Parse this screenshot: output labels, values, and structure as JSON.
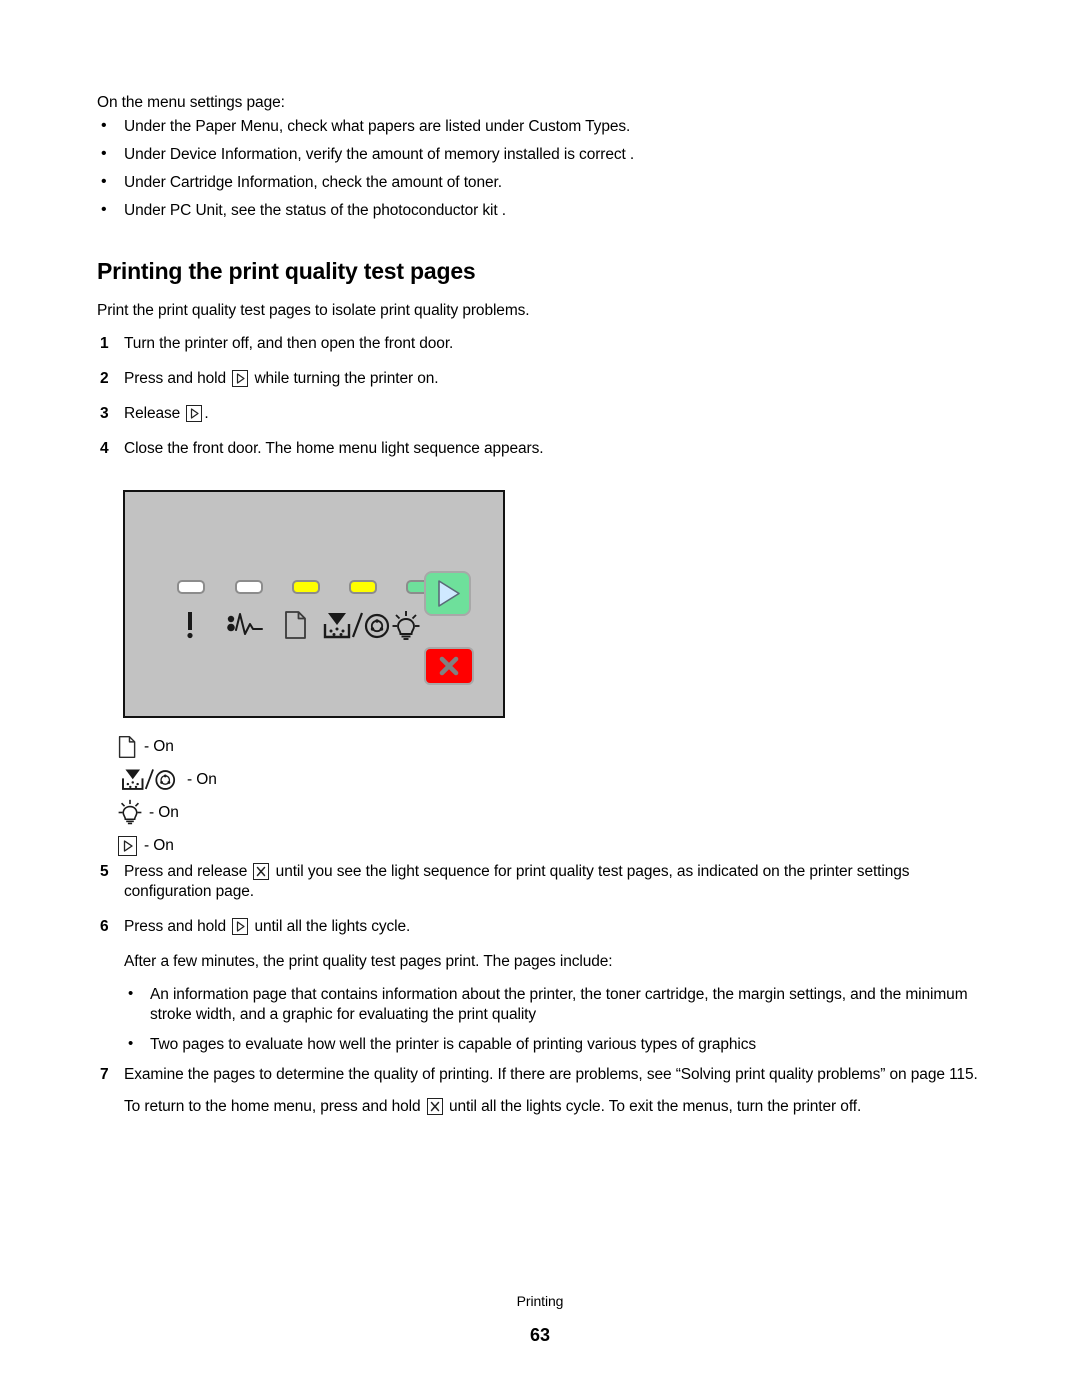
{
  "intro": {
    "lead": "On the menu settings page:",
    "bullets": [
      "Under the Paper Menu, check what papers are listed under Custom Types.",
      "Under Device Information, verify the amount of memory installed is correct .",
      "Under Cartridge Information, check the amount of toner.",
      "Under PC Unit, see the status of the photoconductor kit ."
    ]
  },
  "section": {
    "heading": "Printing the print quality test pages",
    "intro": "Print the print quality test pages to isolate print quality problems."
  },
  "steps": {
    "s1_num": "1",
    "s1_text": "Turn the printer off, and then open the front door.",
    "s2_num": "2",
    "s2_a": "Press and hold",
    "s2_b": "while turning the printer on.",
    "s3_num": "3",
    "s3_a": "Release",
    "s3_b": ".",
    "s4_num": "4",
    "s4_text": "Close the front door. The home menu light sequence appears.",
    "s5_num": "5",
    "s5_a": "Press and release",
    "s5_b": "until you see the light sequence for print quality test pages, as indicated on the printer settings configuration page.",
    "s6_num": "6",
    "s6_a": "Press and hold",
    "s6_b": "until all the lights cycle.",
    "s6_after": "After a few minutes, the print quality test pages print. The pages include:",
    "s6_bullets": [
      "An information page that contains information about the printer, the toner cartridge, the margin settings, and the minimum stroke width, and a graphic for evaluating the print quality",
      "Two pages to evaluate how well the printer is capable of printing various types of graphics"
    ],
    "s7_num": "7",
    "s7_text": "Examine the pages to determine the quality of printing. If there are problems, see “Solving print quality problems” on page 115.",
    "closing_a": "To return to the home menu, press and hold",
    "closing_b": "until all the lights cycle. To exit the menus, turn the printer off."
  },
  "panel": {
    "leds": [
      {
        "name": "error-led",
        "color": "#ffffff"
      },
      {
        "name": "paper-jam-led",
        "color": "#ffffff"
      },
      {
        "name": "load-paper-led",
        "color": "#ffff00"
      },
      {
        "name": "toner-led",
        "color": "#ffff00"
      },
      {
        "name": "ready-led",
        "color": "#6ee09b"
      }
    ],
    "icons": [
      "exclamation-icon",
      "paper-jam-icon",
      "paper-icon",
      "toner-pc-unit-icon",
      "lightbulb-icon"
    ],
    "go_button": "go-button",
    "stop_button": "stop-button",
    "go_color": "#6ee09b",
    "stop_color": "#ff0000"
  },
  "legend": {
    "rows": [
      {
        "icon": "paper-icon",
        "text": "- On"
      },
      {
        "icon": "toner-pc-unit-icon",
        "text": "- On"
      },
      {
        "icon": "lightbulb-icon",
        "text": "- On"
      },
      {
        "icon": "go-key-icon",
        "text": "- On"
      }
    ]
  },
  "footer": {
    "label": "Printing",
    "page": "63"
  }
}
